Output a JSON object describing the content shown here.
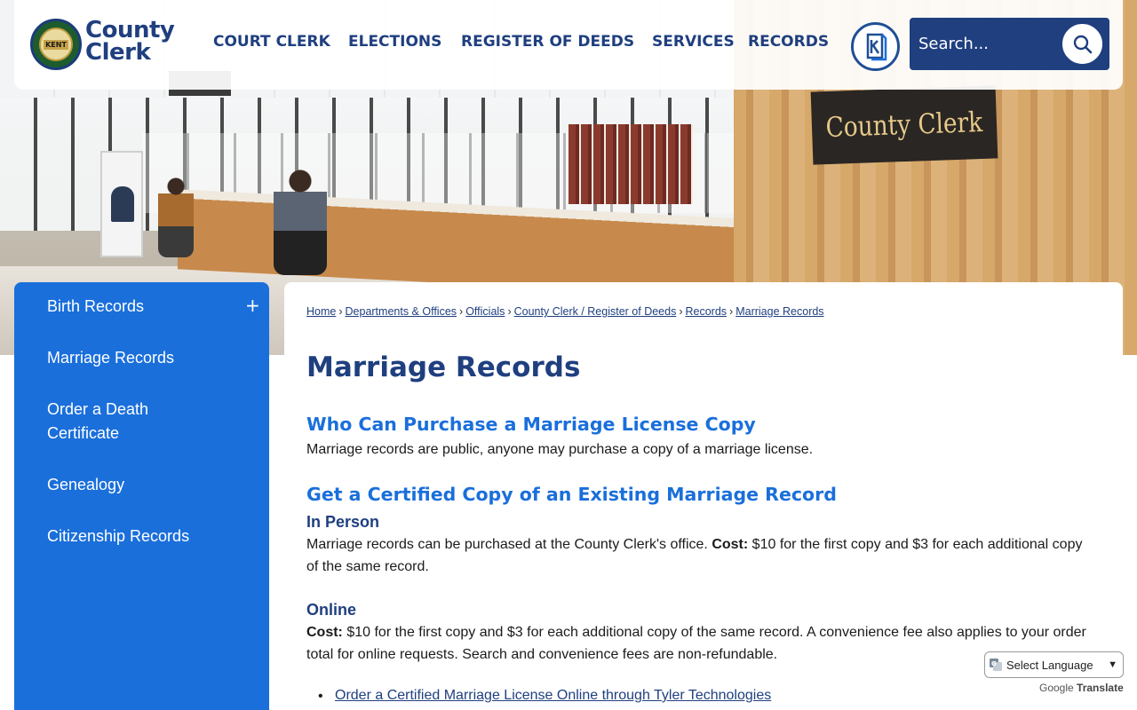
{
  "header": {
    "brand_line1": "County",
    "brand_line2": "Clerk",
    "logo_label": "KENT",
    "nav": [
      "COURT CLERK",
      "ELECTIONS",
      "REGISTER OF DEEDS",
      "SERVICES",
      "RECORDS"
    ],
    "search_placeholder": "Search...",
    "translate_icon": "k-translate-icon"
  },
  "hero": {
    "sign_text": "County Clerk"
  },
  "sidebar": {
    "items": [
      {
        "label": "Birth Records",
        "expandable": true,
        "expand_symbol": "+"
      },
      {
        "label": "Marriage Records"
      },
      {
        "label": "Order a Death Certificate"
      },
      {
        "label": "Genealogy"
      },
      {
        "label": "Citizenship Records"
      }
    ],
    "bg_color": "#1a6fdb"
  },
  "breadcrumbs": [
    "Home",
    "Departments & Offices",
    "Officials",
    "County Clerk / Register of Deeds",
    "Records",
    "Marriage Records"
  ],
  "main": {
    "title": "Marriage Records",
    "section1_heading": "Who Can Purchase a Marriage License Copy",
    "section1_text": "Marriage records are public, anyone may purchase a copy of a marriage license.",
    "section2_heading": "Get a Certified Copy of an Existing Marriage Record",
    "in_person_heading": "In Person",
    "in_person_text": "Marriage records can be purchased at the County Clerk's office.",
    "cost_label": "Cost:",
    "in_person_cost": "$10 for the first copy and $3 for each additional copy of the same record.",
    "online_heading": "Online",
    "online_cost": "$10 for the first copy and $3 for each additional copy of the same record. A convenience fee also applies to your order total for online requests. Search and convenience fees are non-refundable.",
    "online_link": "Order a Certified Marriage License Online through Tyler Technologies"
  },
  "translate": {
    "select_label": "Select Language",
    "powered_by": "Google",
    "translate_word": "Translate"
  },
  "colors": {
    "navy": "#1f3f7f",
    "blue": "#1a6fdb"
  }
}
